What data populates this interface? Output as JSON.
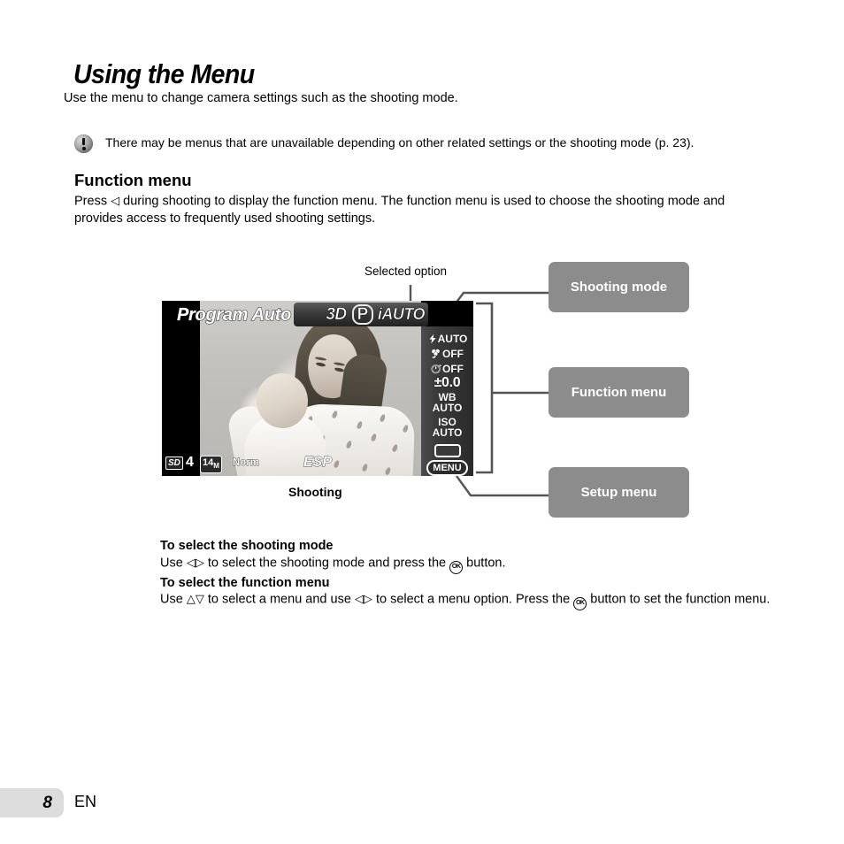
{
  "page": {
    "title": "Using the Menu",
    "intro": "Use the menu to change camera settings such as the shooting mode.",
    "note_icon": "exclamation-circle-icon",
    "note": "There may be menus that are unavailable depending on other related settings or the shooting mode (p. 23).",
    "section": {
      "heading": "Function menu",
      "body_pre": "Press",
      "body_glyph": "◁",
      "body_post": "during shooting to display the function menu. The function menu is used to choose the shooting mode and provides access to frequently used shooting settings."
    }
  },
  "diagram": {
    "selected_option_label": "Selected option",
    "shooting_caption": "Shooting",
    "callouts": [
      {
        "label": "Shooting mode"
      },
      {
        "label": "Function menu"
      },
      {
        "label": "Setup menu"
      }
    ],
    "lcd": {
      "mode_name": "Program Auto",
      "mode_chips": [
        {
          "label": "3D",
          "selected": false
        },
        {
          "label": "P",
          "selected": true
        },
        {
          "label": "iAUTO",
          "selected": false
        }
      ],
      "function_menu": [
        {
          "icon": "flash-icon",
          "value": "AUTO"
        },
        {
          "icon": "macro-flower-icon",
          "value": "OFF"
        },
        {
          "icon": "self-timer-icon",
          "value": "OFF"
        },
        {
          "icon": "exposure-comp-icon",
          "value": "±0.0"
        },
        {
          "icon": "white-balance-icon",
          "label": "WB",
          "value": "AUTO"
        },
        {
          "icon": "iso-icon",
          "label": "ISO",
          "value": "AUTO"
        },
        {
          "icon": "drive-mode-icon",
          "value": ""
        },
        {
          "icon": "menu-button-icon",
          "value": "MENU"
        }
      ],
      "status_bar": {
        "card": "SD",
        "shots_remaining": "4",
        "image_size": "14",
        "image_size_unit": "M",
        "compression": "Norm",
        "metering": "ESP"
      }
    }
  },
  "instructions": [
    {
      "heading": "To select the shooting mode",
      "pre": "Use",
      "glyphs": "◁▷",
      "mid": "to select the shooting mode and press the",
      "button": "OK",
      "post": "button."
    },
    {
      "heading": "To select the function menu",
      "pre": "Use",
      "glyphs": "△▽",
      "mid": "to select a menu and use",
      "glyphs2": "◁▷",
      "mid2": "to select a menu option. Press the",
      "button": "OK",
      "post": "button to set the function menu."
    }
  ],
  "footer": {
    "page_number": "8",
    "language": "EN"
  },
  "colors": {
    "callout_bg": "#8c8c8c",
    "footer_bg": "#dcdcdc",
    "line": "#555555"
  }
}
